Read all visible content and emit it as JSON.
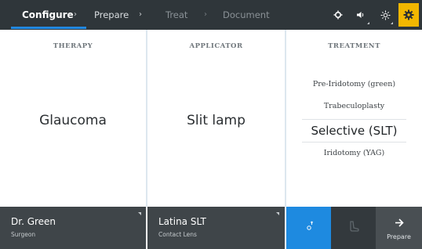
{
  "steps": [
    {
      "label": "Configure",
      "state": "current"
    },
    {
      "label": "Prepare",
      "state": "available"
    },
    {
      "label": "Treat",
      "state": "disabled"
    },
    {
      "label": "Document",
      "state": "disabled"
    }
  ],
  "toolbar": {
    "icons": [
      "brightness-icon",
      "volume-icon",
      "illumination-icon",
      "settings-gear-icon"
    ],
    "active": "settings-gear-icon",
    "accent_color": "#f2b700"
  },
  "panels": {
    "therapy": {
      "title": "THERAPY",
      "value": "Glaucoma"
    },
    "applicator": {
      "title": "APPLICATOR",
      "value": "Slit lamp"
    },
    "treatment": {
      "title": "TREATMENT",
      "items": [
        "Pre-Iridotomy (green)",
        "Trabeculoplasty",
        "Selective (SLT)",
        "Iridotomy (YAG)"
      ],
      "selected": "Selective (SLT)"
    }
  },
  "bottom": {
    "surgeon": {
      "name": "Dr. Green",
      "role": "Surgeon"
    },
    "lens": {
      "name": "Latina SLT",
      "role": "Contact Lens"
    },
    "actions": {
      "aim_icon": "aiming-beam-icon",
      "foot_icon": "footswitch-icon",
      "next_label": "Prepare",
      "active_color": "#1e8ae0"
    }
  }
}
